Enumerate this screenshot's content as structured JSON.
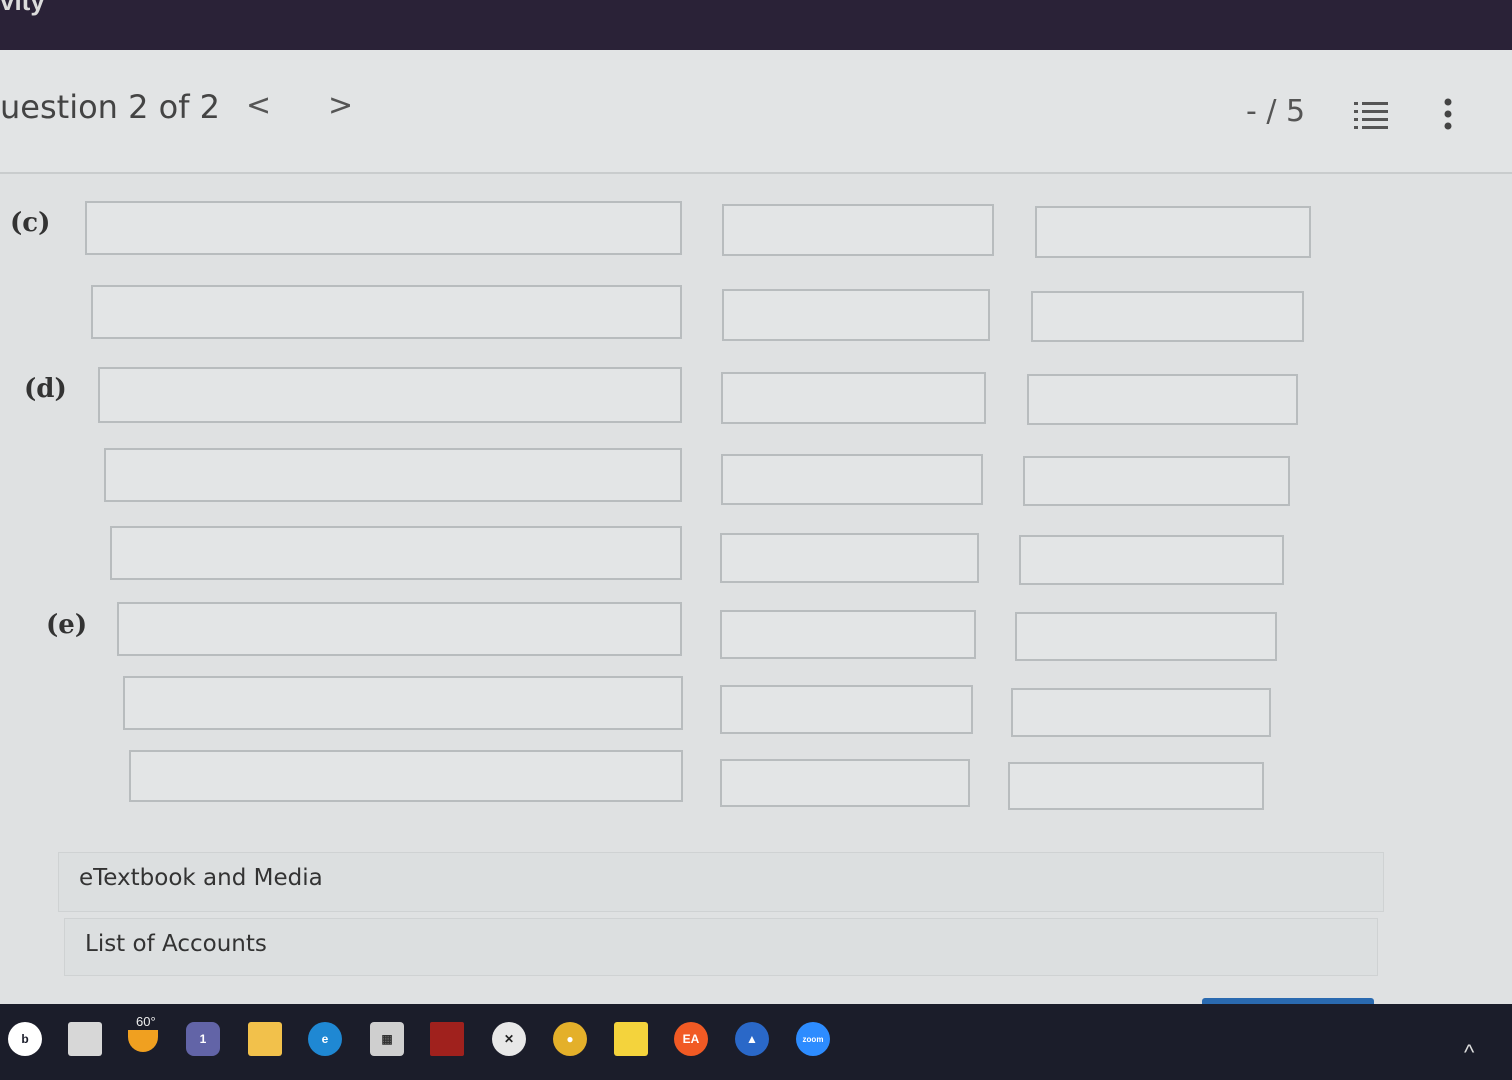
{
  "app": {
    "title_fragment": "vity"
  },
  "header": {
    "question_label": "uestion 2 of 2",
    "prev": "<",
    "next": ">",
    "score": "- / 5",
    "list_icon": "list-icon",
    "more_icon": "more-vertical-icon"
  },
  "parts": {
    "c": "(c)",
    "d": "(d)",
    "e": "(e)"
  },
  "sections": {
    "etextbook": "eTextbook and Media",
    "accounts": "List of Accounts"
  },
  "taskbar": {
    "weather": "60°",
    "icons": [
      "search-icon",
      "task-view-icon",
      "weather-icon",
      "teams-icon",
      "file-explorer-icon",
      "edge-icon",
      "store-icon",
      "game-icon",
      "xbox-icon",
      "chrome-icon",
      "sticky-notes-icon",
      "ea-icon",
      "app-icon",
      "zoom-icon"
    ]
  }
}
